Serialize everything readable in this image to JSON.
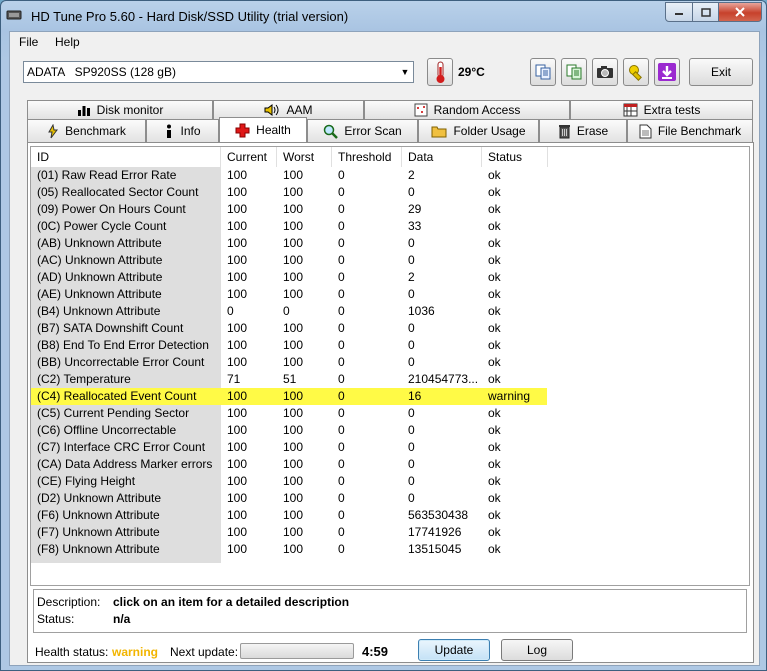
{
  "window": {
    "title": "HD Tune Pro 5.60 - Hard Disk/SSD Utility (trial version)"
  },
  "menu": {
    "file": "File",
    "help": "Help"
  },
  "toolbar": {
    "drive": "ADATA   SP920SS (128 gB)",
    "temperature": "29°C",
    "exit_label": "Exit"
  },
  "tabs_top": [
    "Disk monitor",
    "AAM",
    "Random Access",
    "Extra tests"
  ],
  "tabs_bottom": [
    "Benchmark",
    "Info",
    "Health",
    "Error Scan",
    "Folder Usage",
    "Erase",
    "File Benchmark"
  ],
  "active_tab": "Health",
  "table": {
    "headers": [
      "ID",
      "Current",
      "Worst",
      "Threshold",
      "Data",
      "Status"
    ],
    "rows": [
      [
        "(01) Raw Read Error Rate",
        "100",
        "100",
        "0",
        "2",
        "ok"
      ],
      [
        "(05) Reallocated Sector Count",
        "100",
        "100",
        "0",
        "0",
        "ok"
      ],
      [
        "(09) Power On Hours Count",
        "100",
        "100",
        "0",
        "29",
        "ok"
      ],
      [
        "(0C) Power Cycle Count",
        "100",
        "100",
        "0",
        "33",
        "ok"
      ],
      [
        "(AB) Unknown Attribute",
        "100",
        "100",
        "0",
        "0",
        "ok"
      ],
      [
        "(AC) Unknown Attribute",
        "100",
        "100",
        "0",
        "0",
        "ok"
      ],
      [
        "(AD) Unknown Attribute",
        "100",
        "100",
        "0",
        "2",
        "ok"
      ],
      [
        "(AE) Unknown Attribute",
        "100",
        "100",
        "0",
        "0",
        "ok"
      ],
      [
        "(B4) Unknown Attribute",
        "0",
        "0",
        "0",
        "1036",
        "ok"
      ],
      [
        "(B7) SATA Downshift Count",
        "100",
        "100",
        "0",
        "0",
        "ok"
      ],
      [
        "(B8) End To End Error Detection",
        "100",
        "100",
        "0",
        "0",
        "ok"
      ],
      [
        "(BB) Uncorrectable Error Count",
        "100",
        "100",
        "0",
        "0",
        "ok"
      ],
      [
        "(C2) Temperature",
        "71",
        "51",
        "0",
        "210454773...",
        "ok"
      ],
      [
        "(C4) Reallocated Event Count",
        "100",
        "100",
        "0",
        "16",
        "warning"
      ],
      [
        "(C5) Current Pending Sector",
        "100",
        "100",
        "0",
        "0",
        "ok"
      ],
      [
        "(C6) Offline Uncorrectable",
        "100",
        "100",
        "0",
        "0",
        "ok"
      ],
      [
        "(C7) Interface CRC Error Count",
        "100",
        "100",
        "0",
        "0",
        "ok"
      ],
      [
        "(CA) Data Address Marker errors",
        "100",
        "100",
        "0",
        "0",
        "ok"
      ],
      [
        "(CE) Flying Height",
        "100",
        "100",
        "0",
        "0",
        "ok"
      ],
      [
        "(D2) Unknown Attribute",
        "100",
        "100",
        "0",
        "0",
        "ok"
      ],
      [
        "(F6) Unknown Attribute",
        "100",
        "100",
        "0",
        "563530438",
        "ok"
      ],
      [
        "(F7) Unknown Attribute",
        "100",
        "100",
        "0",
        "17741926",
        "ok"
      ],
      [
        "(F8) Unknown Attribute",
        "100",
        "100",
        "0",
        "13515045",
        "ok"
      ]
    ]
  },
  "description": {
    "desc_label": "Description:",
    "desc_value": "click on an item for a detailed description",
    "status_label": "Status:",
    "status_value": "n/a"
  },
  "footer": {
    "health_label": "Health status:",
    "health_value": "warning",
    "next_update_label": "Next update:",
    "countdown": "4:59",
    "update_label": "Update",
    "log_label": "Log"
  },
  "colors": {
    "warning_row": "#fffa46",
    "health_warning": "#f2b500",
    "accent": "#3c7fb1"
  }
}
